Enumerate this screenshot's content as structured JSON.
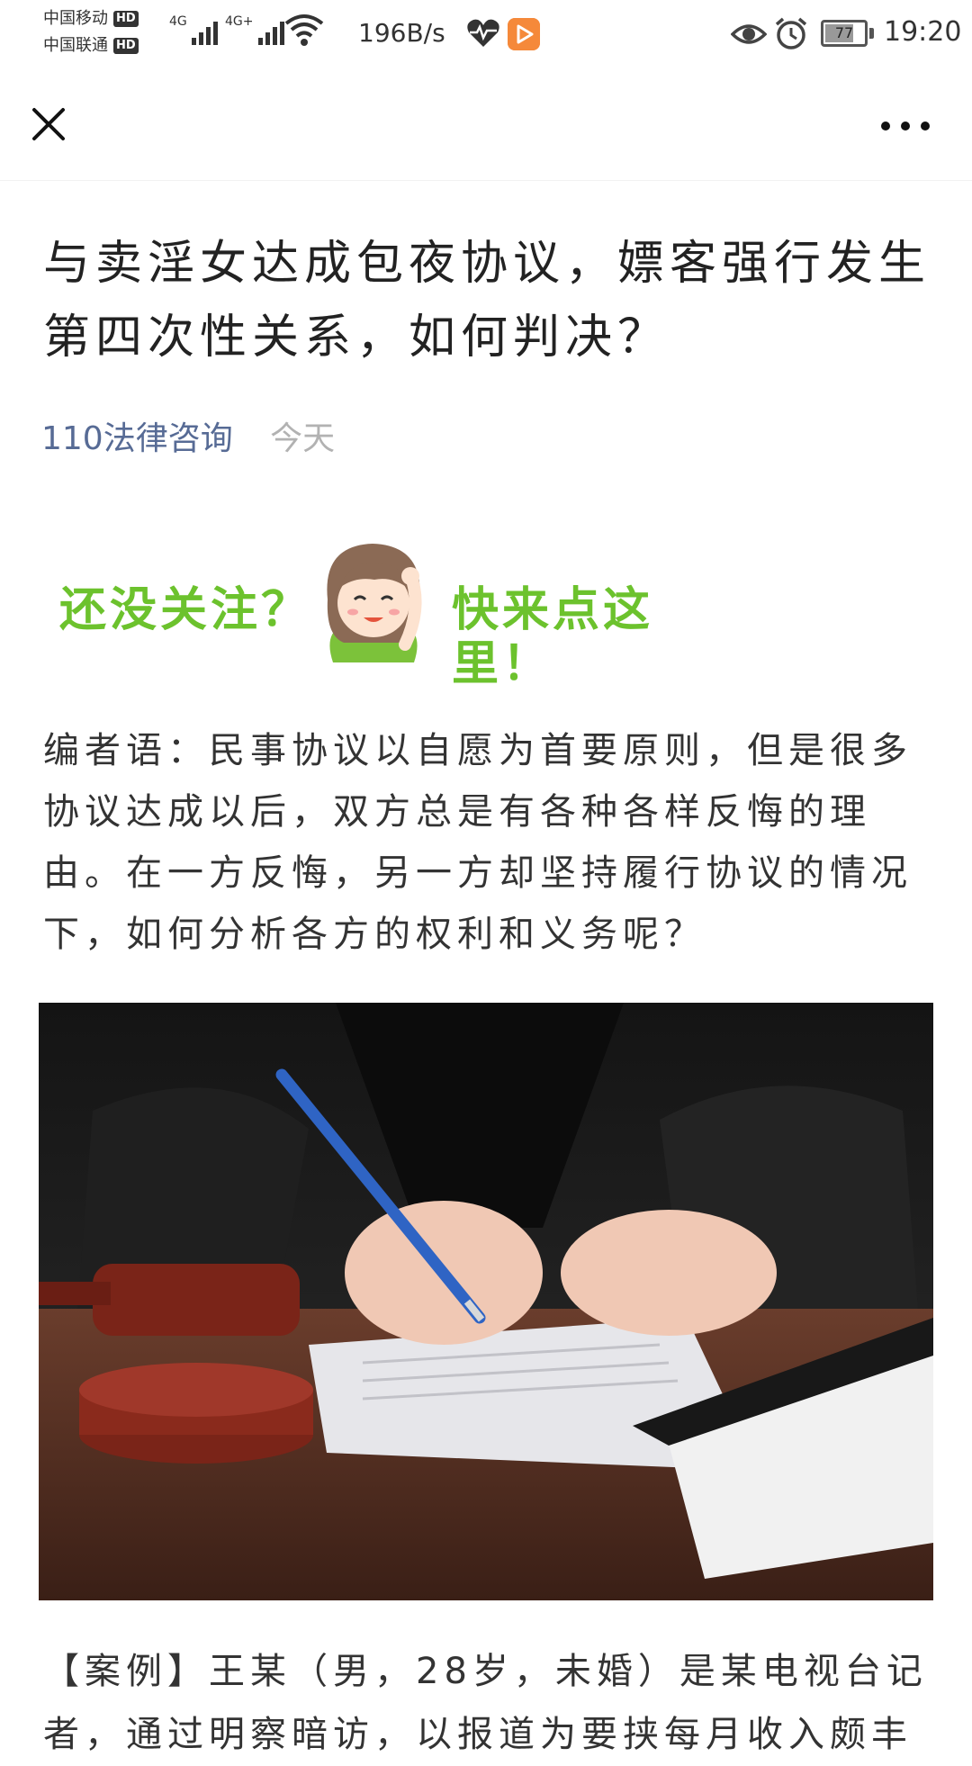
{
  "status_bar": {
    "carrier1": "中国移动",
    "carrier2": "中国联通",
    "hd_label": "HD",
    "net1": "4G",
    "net2": "4G+",
    "speed": "196B/s",
    "battery": "77",
    "time": "19:20",
    "app_badge_color": "#f5893a"
  },
  "article": {
    "title": "与卖淫女达成包夜协议，嫖客强行发生第四次性关系，如何判决？",
    "author": "110法律咨询",
    "date": "今天",
    "banner_left": "还没关注？",
    "banner_right": "快来点这里！",
    "intro": "编者语：民事协议以自愿为首要原则，但是很多协议达成以后，双方总是有各种各样反悔的理由。在一方反悔，另一方却坚持履行协议的情况下，如何分析各方的权利和义务呢？",
    "case_text": "【案例】王某（男，28岁，未婚）是某电视台记者，通过明察暗访，以报道为要挟每月收入颇丰"
  },
  "colors": {
    "author_link": "#576b95",
    "date_gray": "#b2b2b2",
    "banner_green": "#6cc22d"
  },
  "icons": [
    "close-icon",
    "more-icon",
    "wifi-icon",
    "heart-icon",
    "eye-icon",
    "alarm-icon",
    "battery-icon"
  ]
}
